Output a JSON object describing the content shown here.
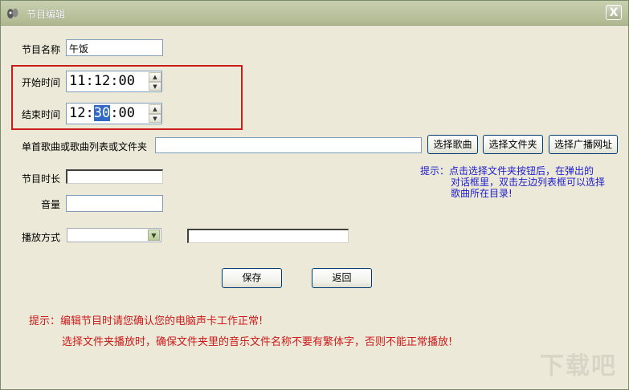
{
  "window": {
    "title": "节目编辑",
    "close_label": "X"
  },
  "fields": {
    "name_label": "节目名称",
    "name_value": "午饭",
    "start_label": "开始时间",
    "start_time": {
      "h": "11",
      "m": "12",
      "s": "00"
    },
    "end_label": "结束时间",
    "end_time": {
      "h": "12",
      "m": "30",
      "s": "00"
    },
    "song_label": "单首歌曲或歌曲列表或文件夹",
    "song_value": "",
    "duration_label": "节目时长",
    "duration_value": "",
    "volume_label": "音量",
    "volume_value": "",
    "playmode_label": "播放方式",
    "playmode_value": "",
    "extra_value": ""
  },
  "buttons": {
    "select_song": "选择歌曲",
    "select_folder": "选择文件夹",
    "select_url": "选择广播网址",
    "save": "保存",
    "back": "返回"
  },
  "hint": {
    "line1": "提示：点击选择文件夹按钮后，在弹出的",
    "line2": "对话框里，双击左边列表框可以选择",
    "line3": "歌曲所在目录!"
  },
  "warnings": {
    "line1": "提示：编辑节目时请您确认您的电脑声卡工作正常!",
    "line2": "选择文件夹播放时，确保文件夹里的音乐文件名称不要有繁体字，否则不能正常播放!"
  },
  "watermark": "下载吧",
  "colors": {
    "window_bg": "#ece9d8",
    "title_bar": "#b9c29c",
    "highlight": "#cc1b1b",
    "hint_text": "#1c1ccc",
    "selection": "#316ac5"
  }
}
